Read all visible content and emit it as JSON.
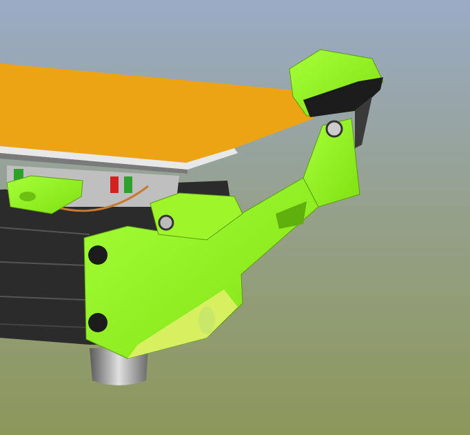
{
  "scene": {
    "colors": {
      "background_top": "#9aabc6",
      "background_bottom": "#8c975a",
      "bed_plate": "#eca414",
      "printed_part": "#8cf516",
      "frame": "#2b2b2b",
      "foot": "#9a9a9a"
    }
  }
}
